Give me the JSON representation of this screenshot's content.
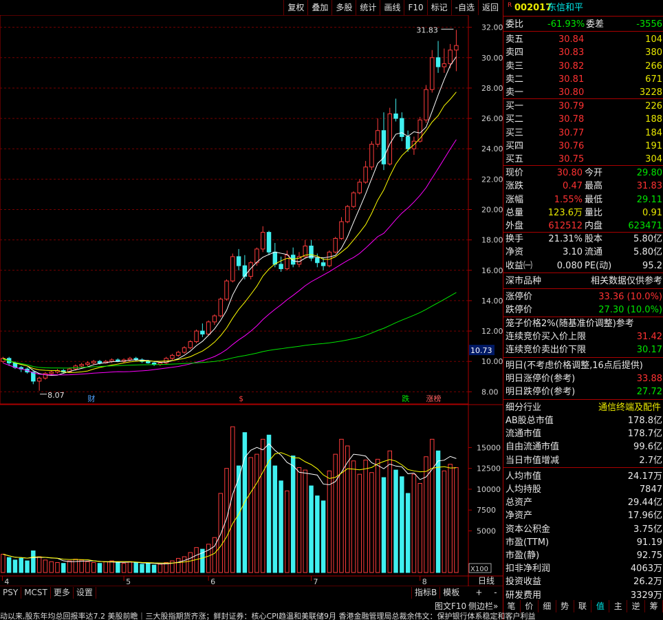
{
  "toolbar": [
    "复权",
    "叠加",
    "多股",
    "统计",
    "画线",
    "F10",
    "标记",
    "-自选",
    "返回"
  ],
  "stock": {
    "code": "002017",
    "name": "东信和平",
    "flag": "R"
  },
  "quote": {
    "weibi_label": "委比",
    "weibi": "-61.93%",
    "weicha_label": "委差",
    "weicha": "-3556",
    "sell": [
      {
        "label": "卖五",
        "price": "30.84",
        "vol": "104"
      },
      {
        "label": "卖四",
        "price": "30.83",
        "vol": "380"
      },
      {
        "label": "卖三",
        "price": "30.82",
        "vol": "266"
      },
      {
        "label": "卖二",
        "price": "30.81",
        "vol": "671"
      },
      {
        "label": "卖一",
        "price": "30.80",
        "vol": "3228"
      }
    ],
    "buy": [
      {
        "label": "买一",
        "price": "30.79",
        "vol": "226"
      },
      {
        "label": "买二",
        "price": "30.78",
        "vol": "188"
      },
      {
        "label": "买三",
        "price": "30.77",
        "vol": "184"
      },
      {
        "label": "买四",
        "price": "30.76",
        "vol": "191"
      },
      {
        "label": "买五",
        "price": "30.75",
        "vol": "304"
      }
    ],
    "stats": [
      {
        "l1": "现价",
        "v1": "30.80",
        "c1": "red",
        "l2": "今开",
        "v2": "29.80",
        "c2": "green"
      },
      {
        "l1": "涨跌",
        "v1": "0.47",
        "c1": "red",
        "l2": "最高",
        "v2": "31.83",
        "c2": "red"
      },
      {
        "l1": "涨幅",
        "v1": "1.55%",
        "c1": "red",
        "l2": "最低",
        "v2": "29.11",
        "c2": "green"
      },
      {
        "l1": "总量",
        "v1": "123.6万",
        "c1": "yellow",
        "l2": "量比",
        "v2": "0.91",
        "c2": "yellow"
      },
      {
        "l1": "外盘",
        "v1": "612512",
        "c1": "red",
        "l2": "内盘",
        "v2": "623471",
        "c2": "green"
      }
    ],
    "stats2": [
      {
        "l1": "换手",
        "v1": "21.31%",
        "l2": "股本",
        "v2": "5.80亿"
      },
      {
        "l1": "净资",
        "v1": "3.10",
        "l2": "流通",
        "v2": "5.80亿"
      },
      {
        "l1": "收益㈠",
        "v1": "0.080",
        "l2": "PE(动)",
        "v2": "95.2"
      }
    ],
    "market_label": "深市品种",
    "ref_label": "相关数据仅供参考",
    "limit_up_label": "涨停价",
    "limit_up": "33.36 (10.0%)",
    "limit_down_label": "跌停价",
    "limit_down": "27.30 (10.0%)",
    "cage": "笼子价格2%(随基准价调整)参考",
    "cont_up_label": "连续竞价买入价上限",
    "cont_up": "31.42",
    "cont_down_label": "连续竞价卖出价下限",
    "cont_down": "30.17",
    "tomorrow": "明日(不考虑价格调整,16点后提供)",
    "tm_up_label": "明日涨停价(参考)",
    "tm_up": "33.88",
    "tm_down_label": "明日跌停价(参考)",
    "tm_down": "27.72",
    "industry_label": "细分行业",
    "industry": "通信终端及配件",
    "fin": [
      {
        "l": "AB股总市值",
        "v": "178.8亿"
      },
      {
        "l": "流通市值",
        "v": "178.7亿"
      },
      {
        "l": "自由流通市值",
        "v": "99.6亿"
      },
      {
        "l": "当日市值增减",
        "v": "2.7亿"
      },
      {
        "l": "人均市值",
        "v": "24.17万"
      },
      {
        "l": "人均持股",
        "v": "7847"
      },
      {
        "l": "总资产",
        "v": "29.44亿"
      },
      {
        "l": "净资产",
        "v": "17.96亿"
      },
      {
        "l": "资本公积金",
        "v": "3.75亿"
      },
      {
        "l": "市盈(TTM)",
        "v": "91.19"
      },
      {
        "l": "市盈(静)",
        "v": "92.75"
      },
      {
        "l": "扣非净利润",
        "v": "4063万"
      },
      {
        "l": "投资收益",
        "v": "26.2万"
      },
      {
        "l": "研发费用",
        "v": "3329万"
      }
    ]
  },
  "bottom_tabs": [
    "PSY",
    "MCST",
    "更多",
    "设置"
  ],
  "bottom_right": [
    "指标B",
    "模板",
    "日线",
    "+",
    "-"
  ],
  "tuwen": "图文F10",
  "cebian": "侧边栏»",
  "right_tabs": [
    "笔",
    "价",
    "细",
    "势",
    "联",
    "值",
    "主",
    "逆",
    "筹"
  ],
  "ticker": "动以来,股东年均总回报率达7.2    美股前瞻｜三大股指期货齐涨；鲜封证券：核心CPI趋温和美联储9月    香港金融管理局总裁余伟文：保护银行体系稳定和客户利益",
  "chart_data": {
    "type": "candlestick",
    "price_axis": {
      "ticks": [
        "32.00",
        "30.00",
        "28.00",
        "26.00",
        "24.00",
        "22.00",
        "20.00",
        "18.00",
        "16.00",
        "14.00",
        "12.00",
        "10.00",
        "8.00"
      ],
      "ylim": [
        7.2,
        32.8
      ]
    },
    "current_price_tag": "10.73",
    "high_label": "31.83",
    "low_label": "8.07",
    "month_labels": [
      "4",
      "5",
      "6",
      "7",
      "8"
    ],
    "event_markers": [
      {
        "text": "财",
        "color": "#4fa3ff"
      },
      {
        "text": "$",
        "color": "#ff4040"
      },
      {
        "text": "跌",
        "color": "#00e600"
      },
      {
        "text": "涨榜",
        "color": "#ff6060"
      }
    ],
    "volume_axis": {
      "ticks": [
        "15000",
        "12500",
        "10000",
        "7500",
        "5000"
      ],
      "unit": "X100",
      "ylim": [
        0,
        19000
      ]
    },
    "candles": [
      [
        10.0,
        10.3,
        9.9,
        10.2
      ],
      [
        10.2,
        10.3,
        9.7,
        9.9
      ],
      [
        9.9,
        10.0,
        9.5,
        9.6
      ],
      [
        9.6,
        9.7,
        9.3,
        9.5
      ],
      [
        9.5,
        9.6,
        9.2,
        9.3
      ],
      [
        9.3,
        9.35,
        8.5,
        8.7
      ],
      [
        8.7,
        9.0,
        8.07,
        8.9
      ],
      [
        8.9,
        9.3,
        8.8,
        9.2
      ],
      [
        9.2,
        9.4,
        9.1,
        9.3
      ],
      [
        9.3,
        9.5,
        9.2,
        9.4
      ],
      [
        9.4,
        9.5,
        9.2,
        9.3
      ],
      [
        9.3,
        9.6,
        9.25,
        9.5
      ],
      [
        9.5,
        9.8,
        9.4,
        9.7
      ],
      [
        9.7,
        9.9,
        9.6,
        9.8
      ],
      [
        9.8,
        10.0,
        9.7,
        9.9
      ],
      [
        9.9,
        10.1,
        9.8,
        10.0
      ],
      [
        10.0,
        10.1,
        9.8,
        9.9
      ],
      [
        9.9,
        10.1,
        9.85,
        10.0
      ],
      [
        10.0,
        10.2,
        9.9,
        10.1
      ],
      [
        10.1,
        10.2,
        9.95,
        10.0
      ],
      [
        10.0,
        10.2,
        9.9,
        10.1
      ],
      [
        10.1,
        10.3,
        10.0,
        10.2
      ],
      [
        10.2,
        10.3,
        10.0,
        10.1
      ],
      [
        10.1,
        10.2,
        9.9,
        10.0
      ],
      [
        10.0,
        10.1,
        9.85,
        9.9
      ],
      [
        9.9,
        10.0,
        9.7,
        9.8
      ],
      [
        9.8,
        10.0,
        9.7,
        9.9
      ],
      [
        9.9,
        10.3,
        9.8,
        10.2
      ],
      [
        10.2,
        10.5,
        10.1,
        10.4
      ],
      [
        10.4,
        10.7,
        10.3,
        10.6
      ],
      [
        10.6,
        11.0,
        10.5,
        10.9
      ],
      [
        10.9,
        11.4,
        10.8,
        11.3
      ],
      [
        11.3,
        12.1,
        11.2,
        12.0
      ],
      [
        12.0,
        12.5,
        11.6,
        11.8
      ],
      [
        11.8,
        12.7,
        11.7,
        12.6
      ],
      [
        12.6,
        13.1,
        12.4,
        13.0
      ],
      [
        13.0,
        14.2,
        12.9,
        14.1
      ],
      [
        14.1,
        15.4,
        14.0,
        15.3
      ],
      [
        15.3,
        17.1,
        15.2,
        16.9
      ],
      [
        16.9,
        17.4,
        16.0,
        16.3
      ],
      [
        16.3,
        17.0,
        15.4,
        15.6
      ],
      [
        15.6,
        16.6,
        15.4,
        16.5
      ],
      [
        16.5,
        17.5,
        16.3,
        17.4
      ],
      [
        17.4,
        18.9,
        17.2,
        18.5
      ],
      [
        18.5,
        18.6,
        17.0,
        17.2
      ],
      [
        17.2,
        17.8,
        16.2,
        16.4
      ],
      [
        16.4,
        16.9,
        15.9,
        16.1
      ],
      [
        16.1,
        17.3,
        16.0,
        17.0
      ],
      [
        17.0,
        17.5,
        16.2,
        16.4
      ],
      [
        16.4,
        17.2,
        16.2,
        16.9
      ],
      [
        16.9,
        18.0,
        16.8,
        17.6
      ],
      [
        17.6,
        18.0,
        16.6,
        16.8
      ],
      [
        16.8,
        17.1,
        16.2,
        16.5
      ],
      [
        16.5,
        16.8,
        16.0,
        16.3
      ],
      [
        16.3,
        17.3,
        16.2,
        17.2
      ],
      [
        17.2,
        18.2,
        17.1,
        18.1
      ],
      [
        18.1,
        19.5,
        18.0,
        19.2
      ],
      [
        19.2,
        20.3,
        19.1,
        20.2
      ],
      [
        20.2,
        21.2,
        20.1,
        21.1
      ],
      [
        21.1,
        22.0,
        21.0,
        21.8
      ],
      [
        21.8,
        23.2,
        21.7,
        22.8
      ],
      [
        22.8,
        24.5,
        22.6,
        24.3
      ],
      [
        24.3,
        26.0,
        24.1,
        25.2
      ],
      [
        25.2,
        26.4,
        22.6,
        23.0
      ],
      [
        23.0,
        26.7,
        22.9,
        26.3
      ],
      [
        26.3,
        27.3,
        25.8,
        26.0
      ],
      [
        26.0,
        26.4,
        24.5,
        24.8
      ],
      [
        24.8,
        25.2,
        23.8,
        24.0
      ],
      [
        24.0,
        24.8,
        23.6,
        24.5
      ],
      [
        24.5,
        26.1,
        24.4,
        25.9
      ],
      [
        25.9,
        28.2,
        25.7,
        27.9
      ],
      [
        27.9,
        30.5,
        27.7,
        30.0
      ],
      [
        30.0,
        31.1,
        29.0,
        29.4
      ],
      [
        29.4,
        30.6,
        29.0,
        29.6
      ],
      [
        29.6,
        30.9,
        29.3,
        30.5
      ],
      [
        30.5,
        31.83,
        29.11,
        30.8
      ]
    ],
    "volumes": [
      2200,
      1800,
      1500,
      1700,
      1400,
      2600,
      1900,
      1500,
      1300,
      1200,
      1100,
      1400,
      1600,
      1500,
      1300,
      1200,
      1100,
      1300,
      1400,
      1200,
      1100,
      1300,
      1200,
      1000,
      1100,
      900,
      1000,
      1200,
      1400,
      1700,
      1900,
      2400,
      3000,
      2800,
      3400,
      4200,
      9500,
      12500,
      17500,
      12800,
      16800,
      13800,
      14200,
      16000,
      16500,
      12800,
      11000,
      9800,
      14000,
      12600,
      12300,
      10400,
      9200,
      8600,
      12200,
      14200,
      16000,
      15200,
      13400,
      11800,
      13500,
      12000,
      13600,
      11400,
      14600,
      12300,
      11500,
      9500,
      11800,
      10700,
      13900,
      16000,
      14600,
      12200,
      13000,
      12600
    ],
    "ma_price": {
      "ma5": "#ffffff",
      "ma10": "#ffff00",
      "ma20": "#ff00ff",
      "ma60": "#00e600"
    },
    "ma_volume": {
      "ma5": "#ffffff",
      "ma10": "#ffff00"
    }
  }
}
